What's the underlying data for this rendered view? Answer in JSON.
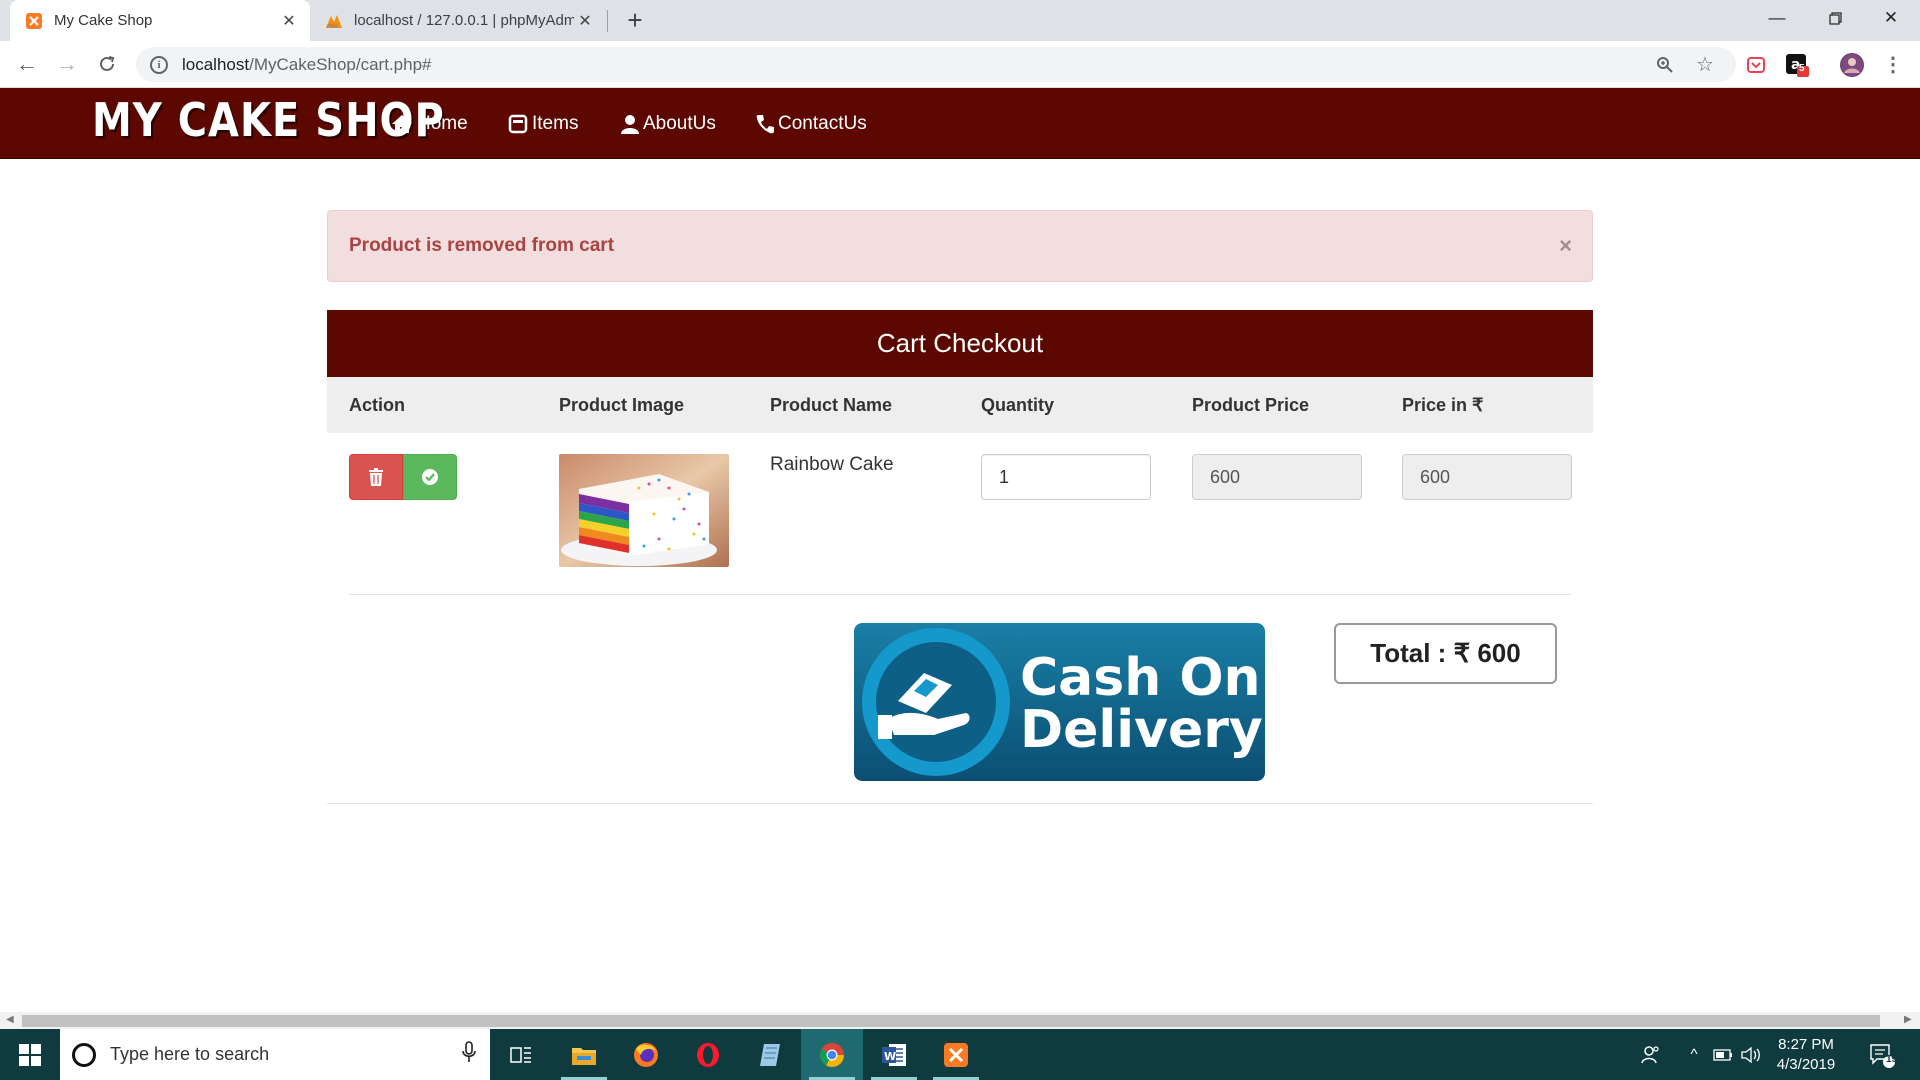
{
  "browser": {
    "tabs": [
      {
        "title": "My Cake Shop",
        "active": true
      },
      {
        "title": "localhost / 127.0.0.1 | phpMyAdm",
        "active": false
      }
    ],
    "url_host": "localhost",
    "url_path": "/MyCakeShop/cart.php#",
    "extension_badge": "5"
  },
  "site": {
    "logo": "MY CAKE SHOP",
    "nav": [
      {
        "label": "Home",
        "icon": "home-icon"
      },
      {
        "label": "Items",
        "icon": "items-icon"
      },
      {
        "label": "AboutUs",
        "icon": "user-icon"
      },
      {
        "label": "ContactUs",
        "icon": "phone-icon"
      }
    ],
    "brand_color": "#5c0800"
  },
  "alert": {
    "message": "Product is removed from cart",
    "close": "×"
  },
  "cart": {
    "title": "Cart Checkout",
    "columns": [
      "Action",
      "Product Image",
      "Product Name",
      "Quantity",
      "Product Price",
      "Price in ₹"
    ],
    "rows": [
      {
        "name": "Rainbow Cake",
        "quantity": "1",
        "price": "600",
        "price_total": "600"
      }
    ],
    "payment_banner": {
      "line1": "Cash On",
      "line2": "Delivery"
    },
    "total": "Total : ₹ 600"
  },
  "taskbar": {
    "search_placeholder": "Type here to search",
    "time": "8:27 PM",
    "date": "4/3/2019",
    "notifications": "19"
  }
}
